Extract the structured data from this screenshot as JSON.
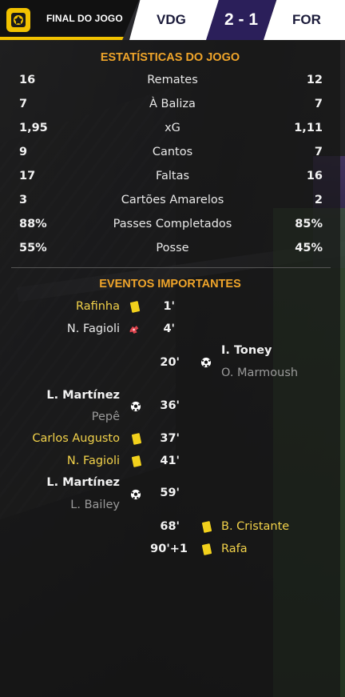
{
  "header": {
    "status": "FINAL DO JOGO",
    "home_team": "VDG",
    "score": "2 - 1",
    "away_team": "FOR"
  },
  "stats": {
    "title": "ESTATÍSTICAS DO JOGO",
    "rows": [
      {
        "home": "16",
        "label": "Remates",
        "away": "12"
      },
      {
        "home": "7",
        "label": "À Baliza",
        "away": "7"
      },
      {
        "home": "1,95",
        "label": "xG",
        "away": "1,11"
      },
      {
        "home": "9",
        "label": "Cantos",
        "away": "7"
      },
      {
        "home": "17",
        "label": "Faltas",
        "away": "16"
      },
      {
        "home": "3",
        "label": "Cartões Amarelos",
        "away": "2"
      },
      {
        "home": "88%",
        "label": "Passes Completados",
        "away": "85%"
      },
      {
        "home": "55%",
        "label": "Posse",
        "away": "45%"
      }
    ]
  },
  "events": {
    "title": "EVENTOS IMPORTANTES",
    "list": [
      {
        "minute": "1'",
        "player": "Rafinha"
      },
      {
        "minute": "4'",
        "player": "N. Fagioli"
      },
      {
        "minute": "20'",
        "player": "I. Toney",
        "assist": "O. Marmoush"
      },
      {
        "minute": "36'",
        "player": "L. Martínez",
        "assist": "Pepê"
      },
      {
        "minute": "37'",
        "player": "Carlos Augusto"
      },
      {
        "minute": "41'",
        "player": "N. Fagioli"
      },
      {
        "minute": "59'",
        "player": "L. Martínez",
        "assist": "L. Bailey"
      },
      {
        "minute": "68'",
        "player": "B. Cristante"
      },
      {
        "minute": "90'+1",
        "player": "Rafa"
      }
    ]
  },
  "icons": {
    "logo": "competition-logo-icon",
    "goal": "football-icon",
    "yellow_card": "yellow-card-icon",
    "injury": "injury-icon"
  },
  "colors": {
    "accent": "#f0a52a",
    "yellow_card": "#f2d11c",
    "score_bg": "#2b1f5a",
    "logo_bg": "#f2c200"
  }
}
